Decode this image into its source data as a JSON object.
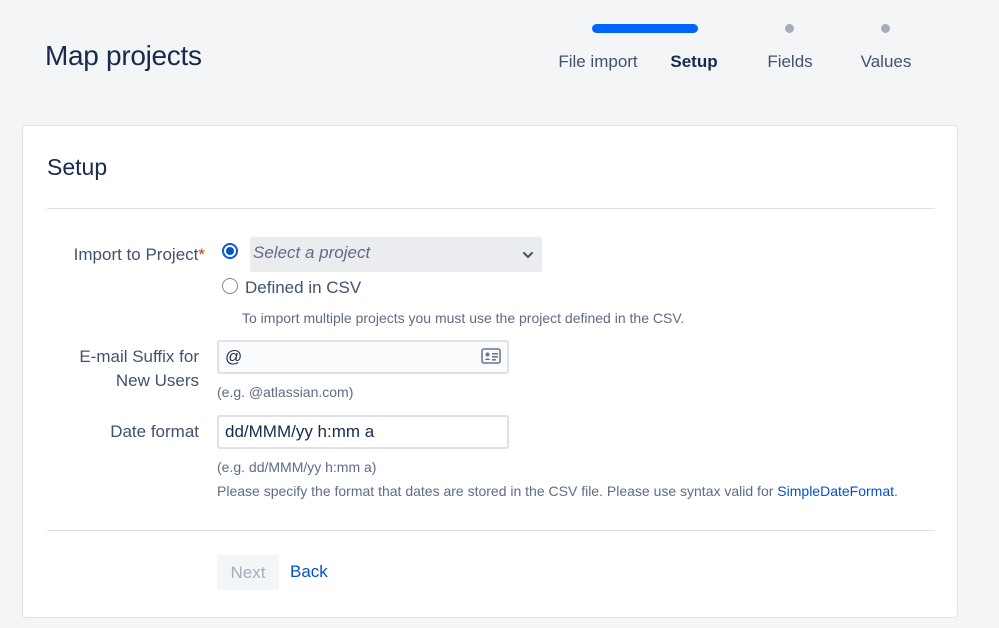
{
  "page": {
    "title": "Map projects"
  },
  "stepper": {
    "steps": [
      {
        "label": "File import",
        "active": false,
        "completed": true
      },
      {
        "label": "Setup",
        "active": true,
        "completed": false
      },
      {
        "label": "Fields",
        "active": false,
        "completed": false
      },
      {
        "label": "Values",
        "active": false,
        "completed": false
      }
    ],
    "accent_color": "#0065ff"
  },
  "card": {
    "title": "Setup",
    "import_project": {
      "label": "Import to Project",
      "required_mark": "*",
      "select_placeholder": "Select a project",
      "radio_select_checked": true,
      "radio_csv_label": "Defined in CSV",
      "radio_csv_checked": false,
      "help": "To import multiple projects you must use the project defined in the CSV."
    },
    "email_suffix": {
      "label_line1": "E-mail Suffix for",
      "label_line2": "New Users",
      "value": "@",
      "help": "(e.g. @atlassian.com)",
      "icon": "contact-card-icon"
    },
    "date_format": {
      "label": "Date format",
      "value": "dd/MMM/yy h:mm a",
      "help_example": "(e.g. dd/MMM/yy h:mm a)",
      "help_text": "Please specify the format that dates are stored in the CSV file. Please use syntax valid for",
      "help_link": "SimpleDateFormat",
      "help_end": "."
    },
    "actions": {
      "next_label": "Next",
      "back_label": "Back"
    }
  }
}
